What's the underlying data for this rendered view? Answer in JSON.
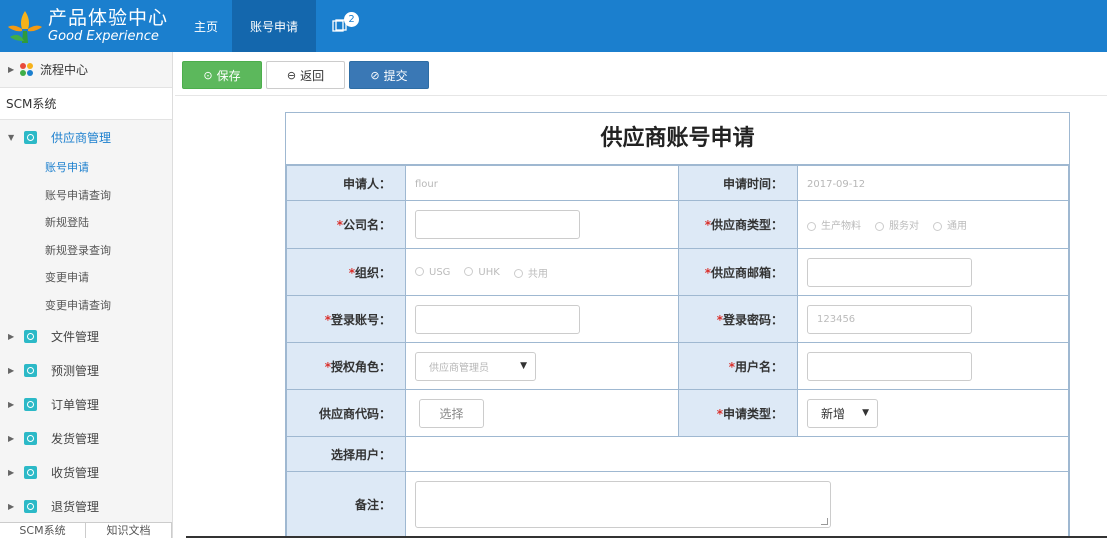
{
  "header": {
    "logo_cn": "产品体验中心",
    "logo_en": "Good Experience",
    "nav": [
      {
        "label": "主页"
      },
      {
        "label": "账号申请"
      }
    ],
    "message_count": "2"
  },
  "sidebar": {
    "flow_center": "流程中心",
    "system_title": "SCM系统",
    "groups": [
      {
        "label": "供应商管理",
        "expanded": true
      },
      {
        "label": "文件管理"
      },
      {
        "label": "预测管理"
      },
      {
        "label": "订单管理"
      },
      {
        "label": "发货管理"
      },
      {
        "label": "收货管理"
      },
      {
        "label": "退货管理"
      }
    ],
    "sub_items": [
      {
        "label": "账号申请",
        "active": true
      },
      {
        "label": "账号申请查询"
      },
      {
        "label": "新规登陆"
      },
      {
        "label": "新规登录查询"
      },
      {
        "label": "变更申请"
      },
      {
        "label": "变更申请查询"
      }
    ],
    "bottom_tabs": [
      "SCM系统",
      "知识文档"
    ]
  },
  "toolbar": {
    "save": "保存",
    "back": "返回",
    "submit": "提交"
  },
  "form": {
    "title": "供应商账号申请",
    "required_mark": "*",
    "applicant_label": "申请人：",
    "applicant_value": "flour",
    "apply_time_label": "申请时间：",
    "apply_time_value": "2017-09-12",
    "company_label": "公司名：",
    "supplier_type_label": "供应商类型：",
    "supplier_type_options": [
      "生产物料",
      "服务对",
      "通用"
    ],
    "org_label": "组织：",
    "org_options": [
      "USG",
      "UHK",
      "共用"
    ],
    "email_label": "供应商邮箱：",
    "login_account_label": "登录账号：",
    "login_password_label": "登录密码：",
    "login_password_value": "123456",
    "role_label": "授权角色：",
    "role_value": "供应商管理员",
    "username_label": "用户名：",
    "supplier_code_label": "供应商代码：",
    "choose_button": "选择",
    "apply_type_label": "申请类型：",
    "apply_type_value": "新增",
    "select_user_label": "选择用户：",
    "remark_label": "备注："
  },
  "colors": {
    "header_blue": "#1b7fce",
    "active_nav": "#1467ad",
    "label_bg": "#dde9f6",
    "save_green": "#5cb85c",
    "submit_blue": "#3a78b5",
    "required_red": "#d9302c"
  }
}
